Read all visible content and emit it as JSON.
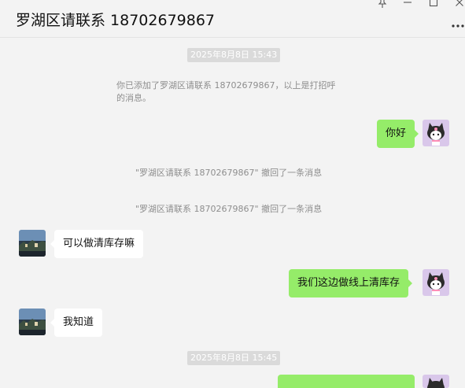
{
  "window": {
    "title": "罗湖区请联系 18702679867",
    "controls": {
      "pin": "pin-icon",
      "minimize": "minimize-icon",
      "maximize": "maximize-icon",
      "close": "close-icon",
      "more": "more-icon"
    }
  },
  "messages": {
    "timestamp_1": "2025年8月8日 15:43",
    "system_added": "你已添加了罗湖区请联系 18702679867，以上是打招呼的消息。",
    "system_added_line1": "你已添加了罗湖区请联系 18702679867，以上是打招呼",
    "system_added_line2": "的消息。",
    "me_hello": "你好",
    "recall_1": "\"罗湖区请联系 18702679867\" 撤回了一条消息",
    "recall_2": "\"罗湖区请联系 18702679867\" 撤回了一条消息",
    "contact_msg_1": "可以做清库存嘛",
    "me_msg_2": "我们这边做线上清库存",
    "contact_msg_2": "我知道",
    "timestamp_2": "2025年8月8日 15:45"
  },
  "colors": {
    "background": "#f3f3f3",
    "outgoing_bubble": "#95ec69",
    "incoming_bubble": "#ffffff",
    "timestamp_bg": "#dadada",
    "system_text": "#8e8e8e"
  },
  "avatars": {
    "contact": "contact-landscape-avatar",
    "self": "self-kuromi-avatar"
  }
}
